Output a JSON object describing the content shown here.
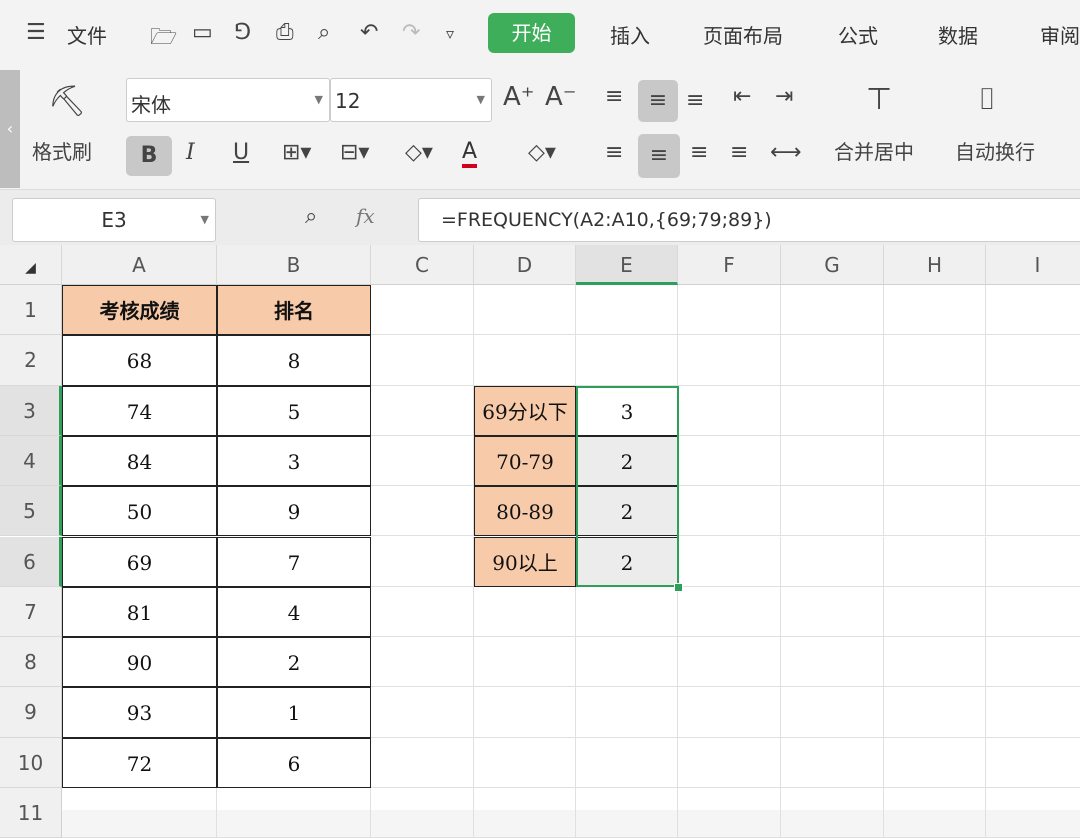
{
  "menubar": {
    "menu_icon": "hamburger-icon",
    "file": "文件",
    "tabs": [
      "开始",
      "插入",
      "页面布局",
      "公式",
      "数据",
      "审阅"
    ],
    "active_tab": "开始",
    "accent": "#3fae5a"
  },
  "ribbon": {
    "format_painter": "格式刷",
    "font_name": "宋体",
    "font_size": "12",
    "merge_center": "合并居中",
    "wrap_text": "自动换行"
  },
  "formula_bar": {
    "cell_ref": "E3",
    "fx": "fx",
    "formula": "=FREQUENCY(A2:A10,{69;79;89})"
  },
  "sheet": {
    "columns": [
      "A",
      "B",
      "C",
      "D",
      "E",
      "F",
      "G",
      "H",
      "I"
    ],
    "rows": [
      "1",
      "2",
      "3",
      "4",
      "5",
      "6",
      "7",
      "8",
      "9",
      "10",
      "11"
    ],
    "table_headers": [
      "考核成绩",
      "排名"
    ],
    "scores": [
      "68",
      "74",
      "84",
      "50",
      "69",
      "81",
      "90",
      "93",
      "72"
    ],
    "ranks": [
      "8",
      "5",
      "3",
      "9",
      "7",
      "4",
      "2",
      "1",
      "6"
    ],
    "bins": [
      "69分以下",
      "70-79",
      "80-89",
      "90以上"
    ],
    "frequency": [
      "3",
      "2",
      "2",
      "2"
    ],
    "selected_range": "E3:E6",
    "header_fill": "#f7caa9",
    "selection_color": "#2e9e5b"
  }
}
